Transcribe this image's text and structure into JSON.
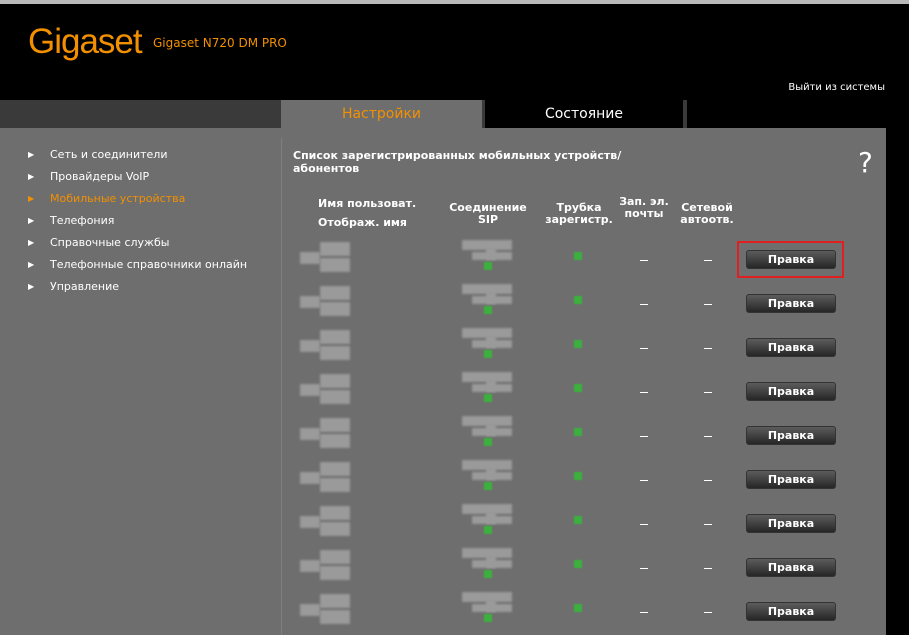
{
  "brand": {
    "logo": "Gigaset",
    "model": "Gigaset N720 DM PRO"
  },
  "header": {
    "logout_label": "Выйти из системы"
  },
  "tabs": [
    {
      "label": "Настройки",
      "active": true
    },
    {
      "label": "Состояние",
      "active": false
    }
  ],
  "sidebar": {
    "items": [
      {
        "label": "Сеть и соединители"
      },
      {
        "label": "Провайдеры VoIP"
      },
      {
        "label": "Мобильные устройства",
        "active": true
      },
      {
        "label": "Телефония"
      },
      {
        "label": "Справочные службы"
      },
      {
        "label": "Телефонные справочники онлайн"
      },
      {
        "label": "Управление"
      }
    ]
  },
  "main": {
    "title": "Список зарегистрированных мобильных устройств/ абонентов",
    "help_glyph": "?",
    "columns": {
      "user_name": "Имя пользоват.",
      "display_name": "Отображ. имя",
      "sip": "Соединение SIP",
      "handset": "Трубка зарегистр.",
      "email": "Зап. эл. почты",
      "network_answer": "Сетевой автоотв."
    },
    "rows": [
      {
        "email": "–",
        "network_answer": "–",
        "action": "Правка",
        "highlighted": true
      },
      {
        "email": "–",
        "network_answer": "–",
        "action": "Правка"
      },
      {
        "email": "–",
        "network_answer": "–",
        "action": "Правка"
      },
      {
        "email": "–",
        "network_answer": "–",
        "action": "Правка"
      },
      {
        "email": "–",
        "network_answer": "–",
        "action": "Правка"
      },
      {
        "email": "–",
        "network_answer": "–",
        "action": "Правка"
      },
      {
        "email": "–",
        "network_answer": "–",
        "action": "Правка"
      },
      {
        "email": "–",
        "network_answer": "–",
        "action": "Правка"
      },
      {
        "email": "–",
        "network_answer": "–",
        "action": "Правка"
      }
    ]
  },
  "colors": {
    "accent": "#f39000",
    "panel": "#6e6e6e",
    "highlight": "#e02020",
    "ok": "#3cb03c"
  }
}
